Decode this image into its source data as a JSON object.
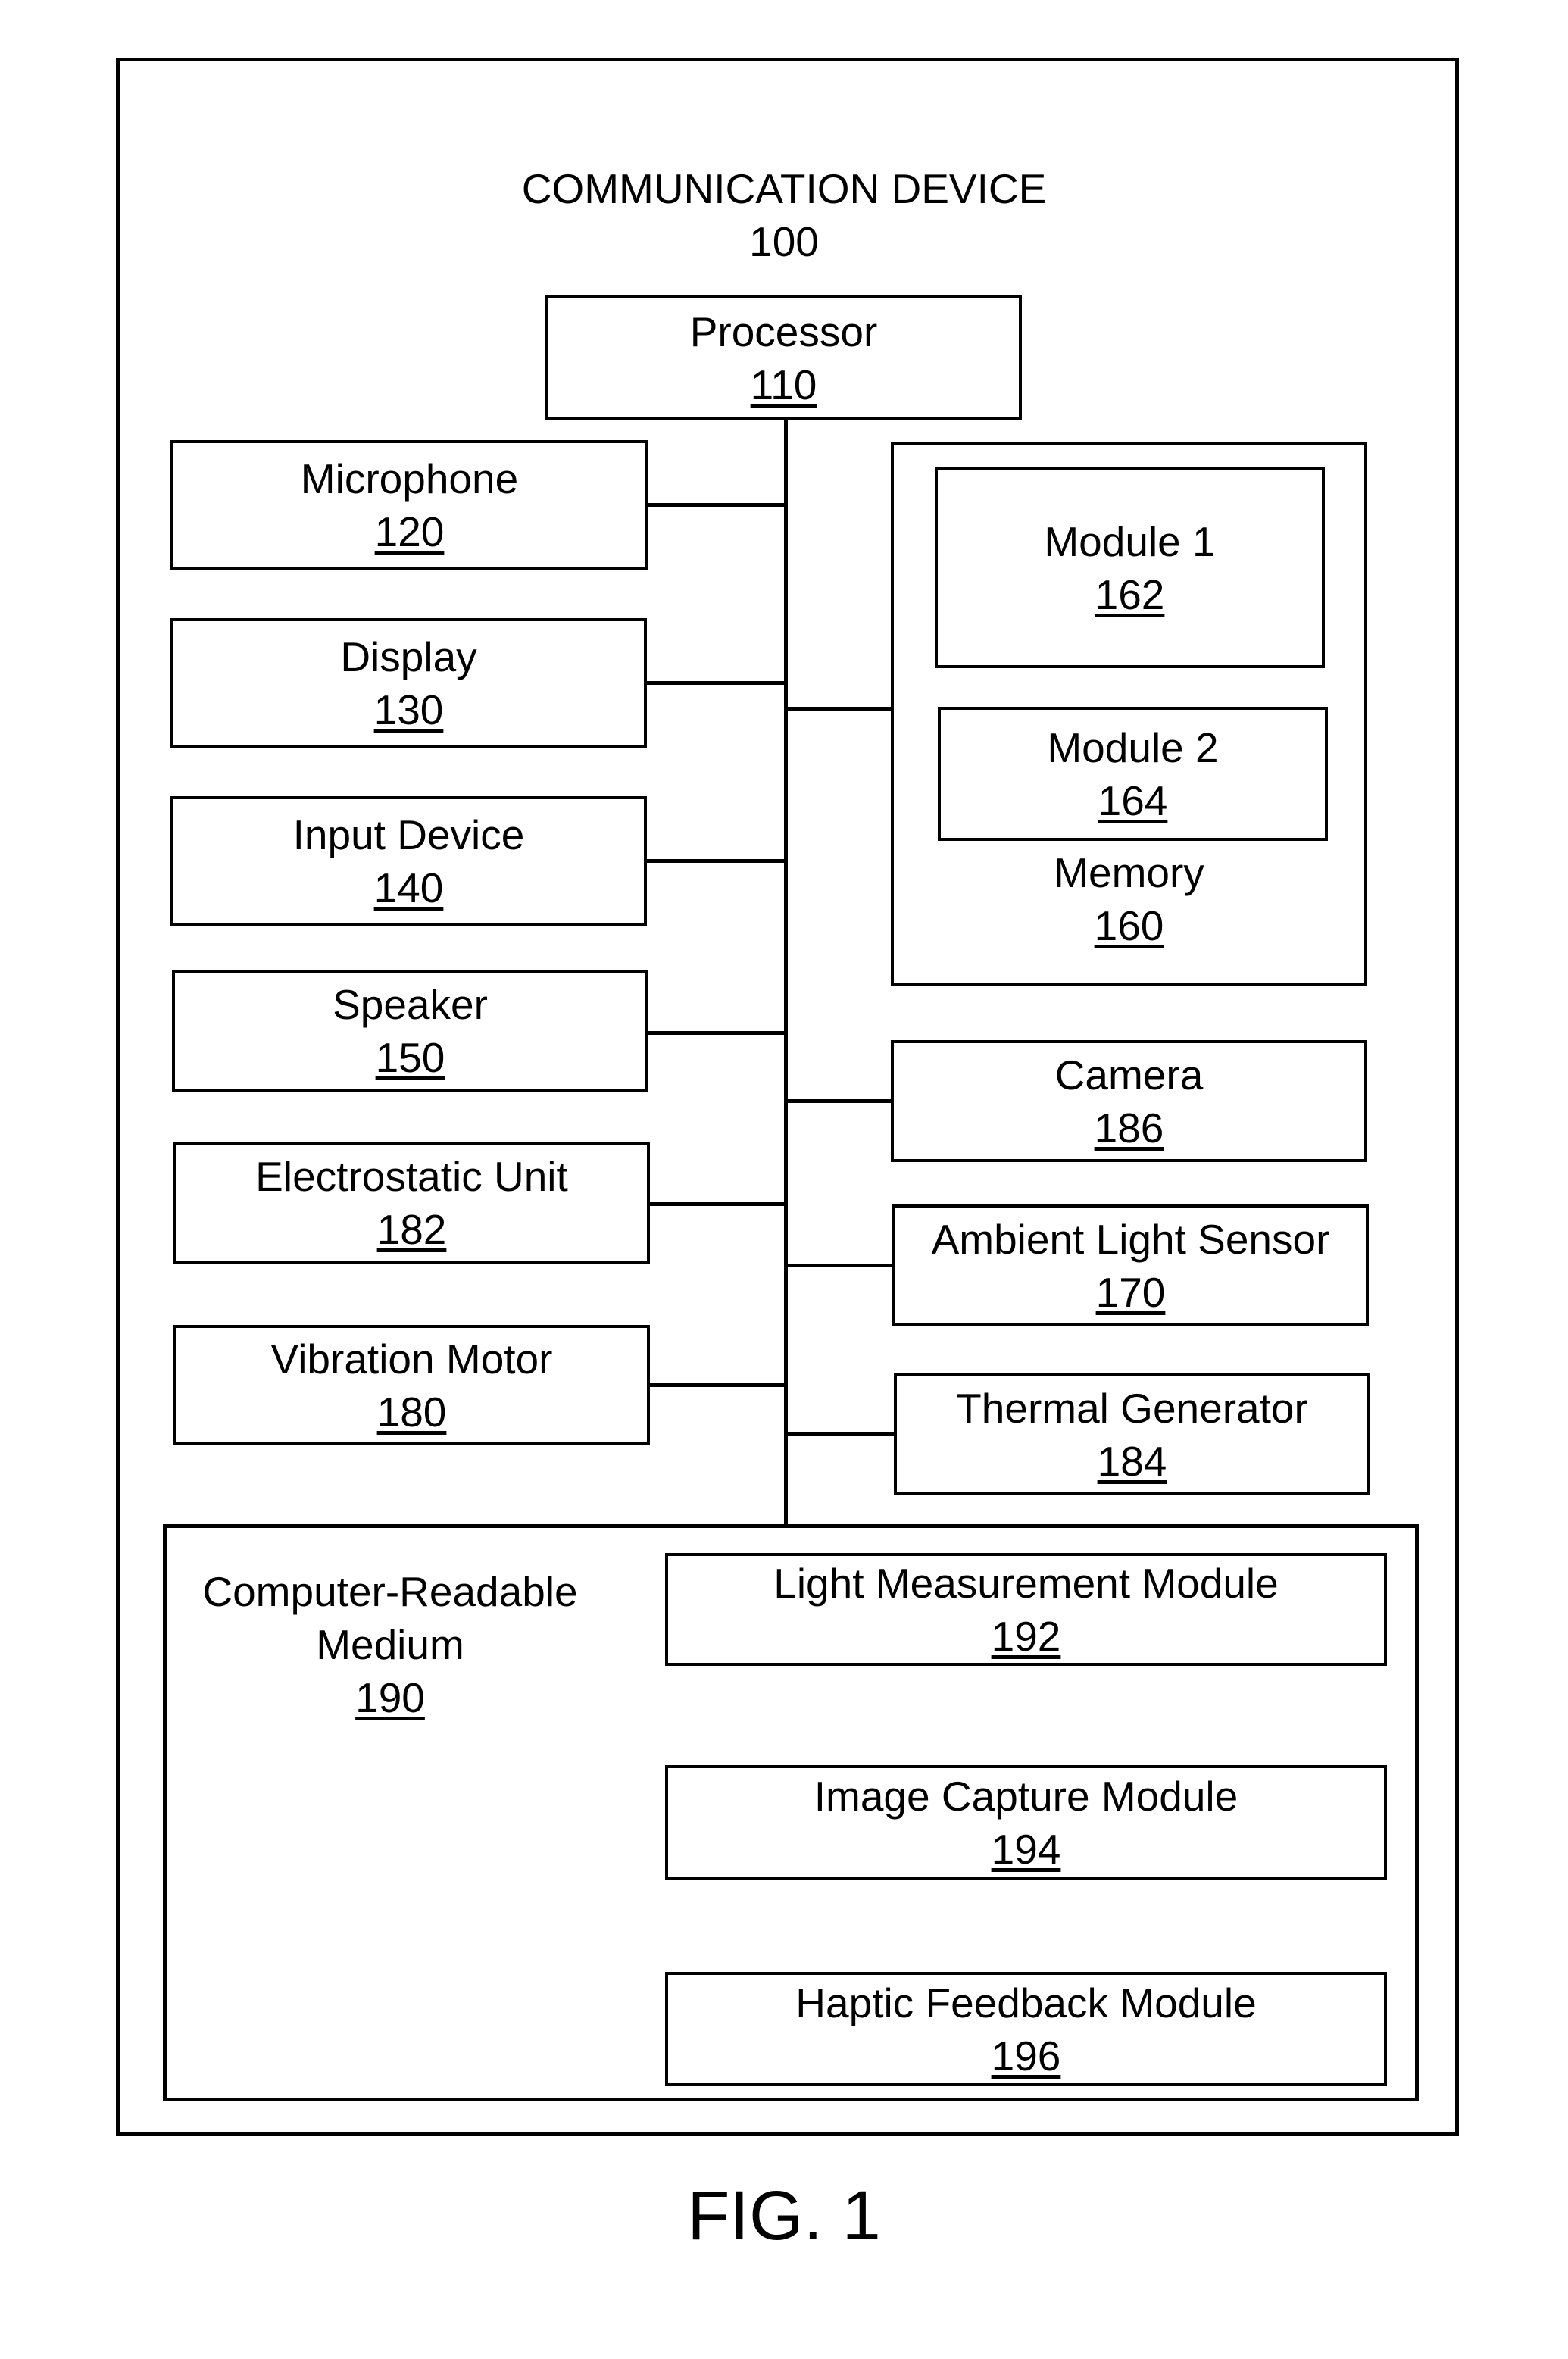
{
  "diagram": {
    "title": "COMMUNICATION DEVICE",
    "title_ref": "100",
    "figure_caption": "FIG. 1",
    "processor": {
      "label": "Processor",
      "ref": "110"
    },
    "left_components": [
      {
        "label": "Microphone",
        "ref": "120"
      },
      {
        "label": "Display",
        "ref": "130"
      },
      {
        "label": "Input Device",
        "ref": "140"
      },
      {
        "label": "Speaker",
        "ref": "150"
      },
      {
        "label": "Electrostatic Unit",
        "ref": "182"
      },
      {
        "label": "Vibration Motor",
        "ref": "180"
      }
    ],
    "memory": {
      "label": "Memory",
      "ref": "160",
      "modules": [
        {
          "label": "Module 1",
          "ref": "162"
        },
        {
          "label": "Module 2",
          "ref": "164"
        }
      ]
    },
    "right_components": [
      {
        "label": "Camera",
        "ref": "186"
      },
      {
        "label": "Ambient Light Sensor",
        "ref": "170"
      },
      {
        "label": "Thermal Generator",
        "ref": "184"
      }
    ],
    "crm": {
      "label_line1": "Computer-Readable",
      "label_line2": "Medium",
      "ref": "190",
      "modules": [
        {
          "label": "Light Measurement Module",
          "ref": "192"
        },
        {
          "label": "Image Capture Module",
          "ref": "194"
        },
        {
          "label": "Haptic Feedback Module",
          "ref": "196"
        }
      ]
    }
  }
}
